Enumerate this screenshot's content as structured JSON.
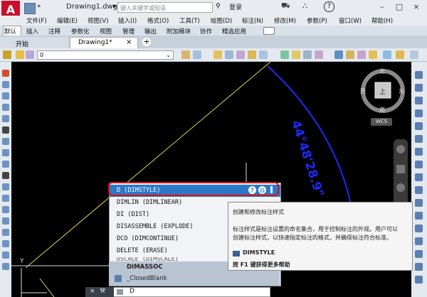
{
  "app": {
    "logo_letter": "A",
    "doc_title": "Drawing1.dwg",
    "search_placeholder": "键入关键字或短语",
    "login": "登录",
    "help_icon": "?"
  },
  "menu": [
    "文件(F)",
    "编辑(E)",
    "视图(V)",
    "插入(I)",
    "格式(O)",
    "工具(T)",
    "绘图(D)",
    "标注(N)",
    "修改(M)",
    "参数(P)",
    "窗口(W)",
    "帮助(H)"
  ],
  "ribbon_tabs": [
    "默认",
    "插入",
    "注释",
    "参数化",
    "视图",
    "管理",
    "输出",
    "附加模块",
    "协作",
    "精选应用"
  ],
  "doc_tabs": {
    "start": "开始",
    "drawing": "Drawing1*",
    "close": "×",
    "add": "+"
  },
  "layer": {
    "value": "0"
  },
  "viewcube": {
    "north": "北",
    "south": "南",
    "west": "西",
    "east": "东",
    "top": "上",
    "wcs": "WCS"
  },
  "dimension_text": "44°48'28.9\"",
  "autocomplete": [
    "D (DIMSTYLE)",
    "DIMLIN (DIMLINEAR)",
    "DI (DIST)",
    "DISASSEMBLE (EXPLODE)",
    "DCO (DIMCONTINUE)",
    "DELETE (ERASE)"
  ],
  "ac_partial": "DSCALE (DIMSCALE)",
  "ac_footer": {
    "sysvar": "DIMASSOC",
    "block": "_ClosedBlank"
  },
  "tooltip": {
    "summary": "创建和修改标注样式",
    "line1": "标注样式是标注设置的命名集合，用于控制标注的外观。用户可以",
    "line2": "创建标注样式，以快速指定标注的格式，并确保标注符合标准。",
    "command": "DIMSTYLE",
    "help": "按 F1 键获得更多帮助"
  },
  "cmdline": {
    "value": "D"
  },
  "ucs": {
    "y": "Y"
  }
}
